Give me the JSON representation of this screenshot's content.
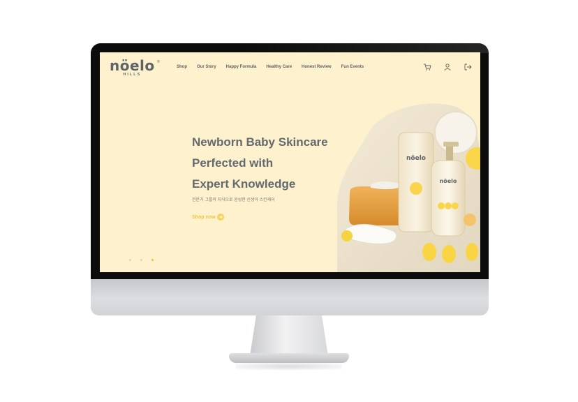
{
  "site": {
    "logo": "nöelo",
    "logo_sub": "HILLS",
    "logo_reg": "®"
  },
  "nav": {
    "items": [
      {
        "label": "Shop"
      },
      {
        "label": "Our Story"
      },
      {
        "label": "Happy Formula"
      },
      {
        "label": "Healthy Care"
      },
      {
        "label": "Honest Review"
      },
      {
        "label": "Fun Events"
      }
    ],
    "icons": [
      "cart-icon",
      "user-icon",
      "logout-icon"
    ]
  },
  "hero": {
    "title_line1": "Newborn Baby Skincare",
    "title_line2": "Perfected with",
    "title_line3": "Expert Knowledge",
    "subtitle": "전문가 그룹의 지식으로 완성한 신생아 스킨케어",
    "cta_label": "Shop now",
    "carousel": {
      "count": 3,
      "active_index": 2
    },
    "product_tube_brand": "nöelo",
    "product_bottle_brand": "nöelo"
  },
  "colors": {
    "page_bg": "#fef1cd",
    "text": "#636a6f",
    "accent": "#f5c030"
  }
}
